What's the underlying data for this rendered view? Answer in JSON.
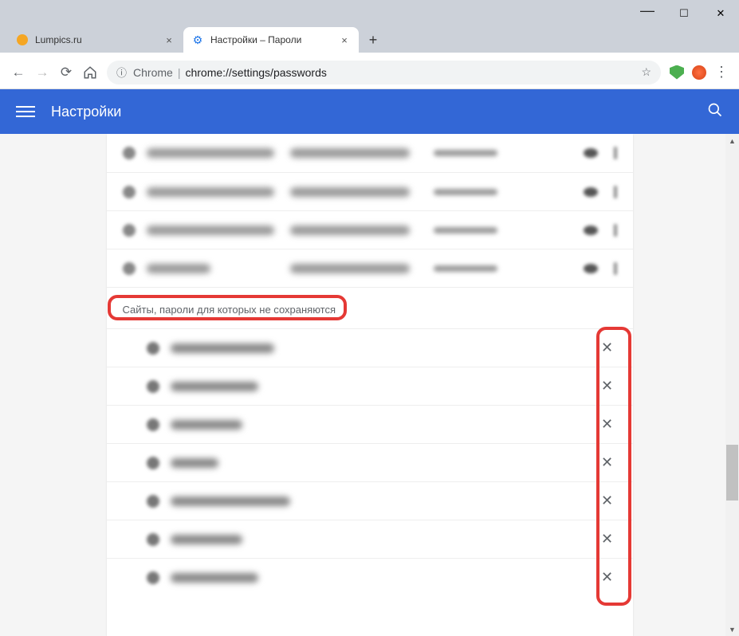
{
  "window": {
    "minimize": "—",
    "maximize": "☐",
    "close": "✕"
  },
  "tabs": [
    {
      "title": "Lumpics.ru",
      "active": false,
      "favicon": "orange"
    },
    {
      "title": "Настройки – Пароли",
      "active": true,
      "favicon": "gear"
    }
  ],
  "newtab_label": "+",
  "toolbar": {
    "back": "←",
    "forward": "→",
    "reload": "⟳",
    "home": "⌂",
    "secure_icon": "ⓘ",
    "chrome_label": "Chrome",
    "url": "chrome://settings/passwords",
    "star": "☆",
    "menu": "⋮"
  },
  "settings": {
    "title": "Настройки",
    "search_icon": "search"
  },
  "section_heading": "Сайты, пароли для которых не сохраняются",
  "never_rows_count": 7,
  "x_glyph": "✕"
}
